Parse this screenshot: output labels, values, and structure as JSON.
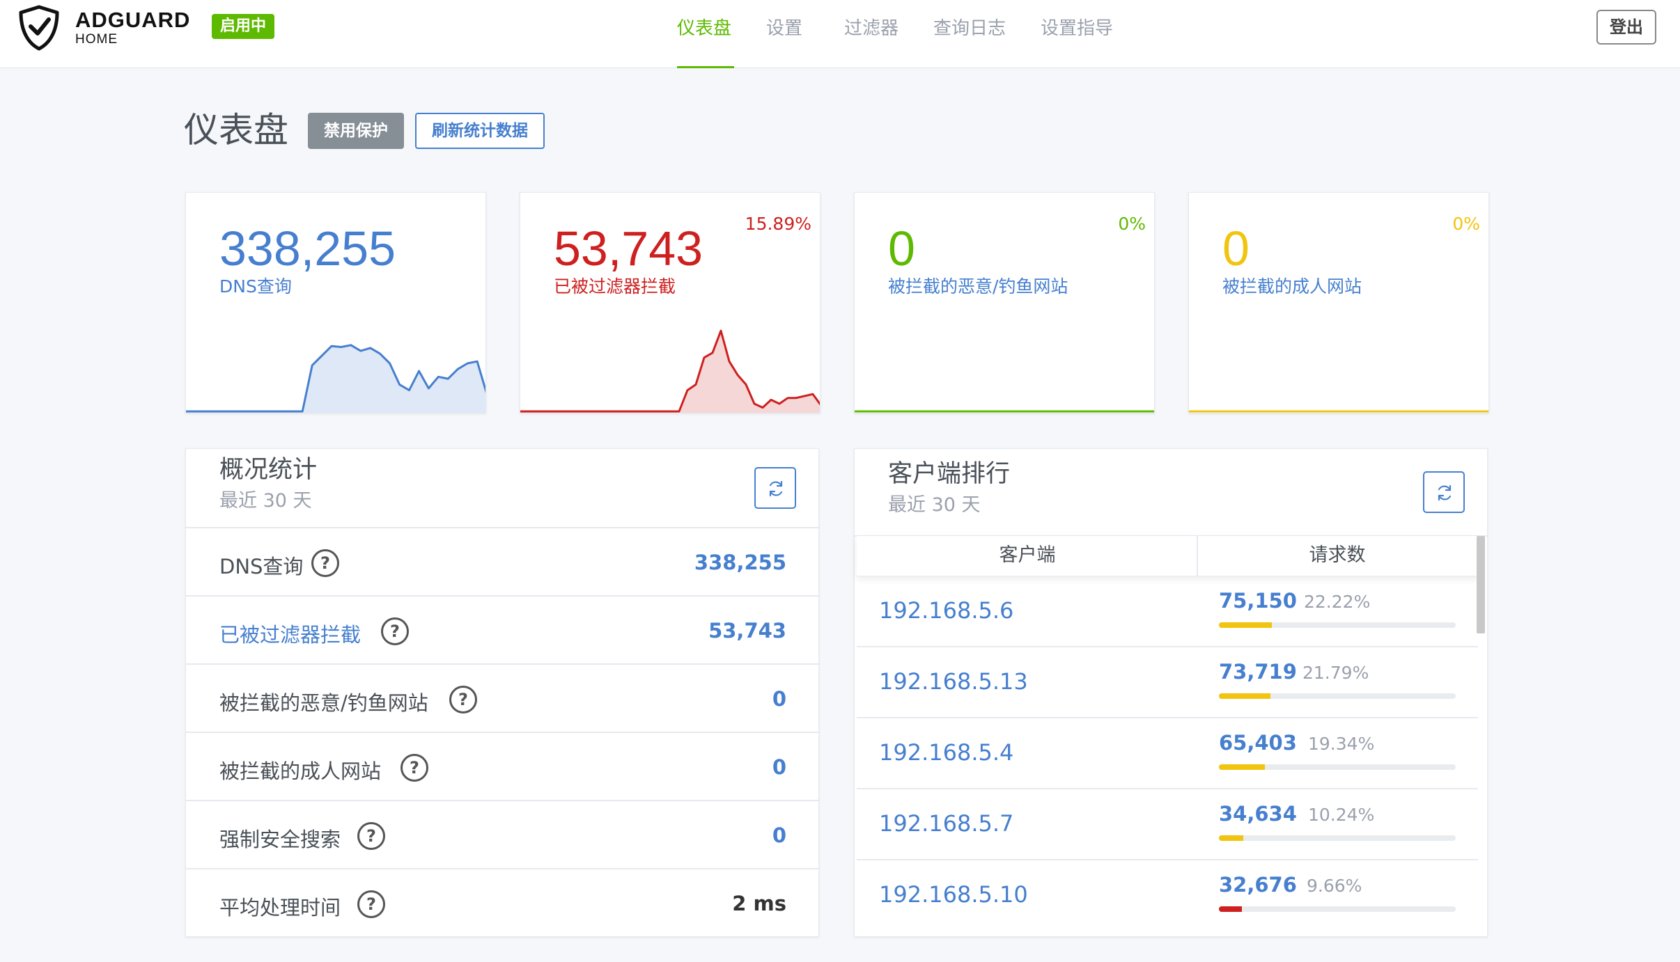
{
  "header": {
    "brand_title": "ADGUARD",
    "brand_sub": "HOME",
    "status_badge": "启用中",
    "nav": [
      "仪表盘",
      "设置",
      "过滤器",
      "查询日志",
      "设置指导"
    ],
    "active_nav": "仪表盘",
    "logout": "登出",
    "accent_color": "#5eba00"
  },
  "toolbar": {
    "title": "仪表盘",
    "disable_protection": "禁用保护",
    "refresh_stats": "刷新统计数据"
  },
  "stats_cards": [
    {
      "value": "338,255",
      "label": "DNS查询",
      "percent": "",
      "color": "#467fcf",
      "sparkline": [
        0,
        0,
        0,
        0,
        0,
        0,
        0,
        0,
        0,
        0,
        0,
        0,
        0,
        48,
        58,
        68,
        67,
        69,
        63,
        66,
        60,
        50,
        28,
        22,
        42,
        24,
        36,
        34,
        44,
        50,
        52,
        18
      ]
    },
    {
      "value": "53,743",
      "label": "已被过滤器拦截",
      "percent": "15.89%",
      "color": "#cd201f",
      "sparkline": [
        0,
        0,
        0,
        0,
        0,
        0,
        0,
        0,
        0,
        0,
        0,
        0,
        0,
        0,
        0,
        0,
        0,
        0,
        0,
        0,
        22,
        28,
        56,
        61,
        84,
        52,
        38,
        28,
        8,
        4,
        12,
        8,
        14,
        14,
        16,
        18,
        6
      ]
    },
    {
      "value": "0",
      "label": "被拦截的恶意/钓鱼网站",
      "percent": "0%",
      "color": "#5eba00",
      "sparkline": []
    },
    {
      "value": "0",
      "label": "被拦截的成人网站",
      "percent": "0%",
      "color": "#f1c40f",
      "sparkline": []
    }
  ],
  "overview": {
    "title": "概况统计",
    "subtitle": "最近 30 天",
    "rows": [
      {
        "label": "DNS查询",
        "value": "338,255"
      },
      {
        "label": "已被过滤器拦截",
        "value": "53,743"
      },
      {
        "label": "被拦截的恶意/钓鱼网站",
        "value": "0"
      },
      {
        "label": "被拦截的成人网站",
        "value": "0"
      },
      {
        "label": "强制安全搜索",
        "value": "0"
      },
      {
        "label": "平均处理时间",
        "value": "2 ms"
      }
    ]
  },
  "clients": {
    "title": "客户端排行",
    "subtitle": "最近 30 天",
    "col_client": "客户端",
    "col_requests": "请求数",
    "rows": [
      {
        "ip": "192.168.5.6",
        "count": "75,150",
        "percent": "22.22%",
        "share": 22.22,
        "bar_color": "#f1c40f"
      },
      {
        "ip": "192.168.5.13",
        "count": "73,719",
        "percent": "21.79%",
        "share": 21.79,
        "bar_color": "#f1c40f"
      },
      {
        "ip": "192.168.5.4",
        "count": "65,403",
        "percent": "19.34%",
        "share": 19.34,
        "bar_color": "#f1c40f"
      },
      {
        "ip": "192.168.5.7",
        "count": "34,634",
        "percent": "10.24%",
        "share": 10.24,
        "bar_color": "#f1c40f"
      },
      {
        "ip": "192.168.5.10",
        "count": "32,676",
        "percent": "9.66%",
        "share": 9.66,
        "bar_color": "#cd201f"
      }
    ]
  }
}
